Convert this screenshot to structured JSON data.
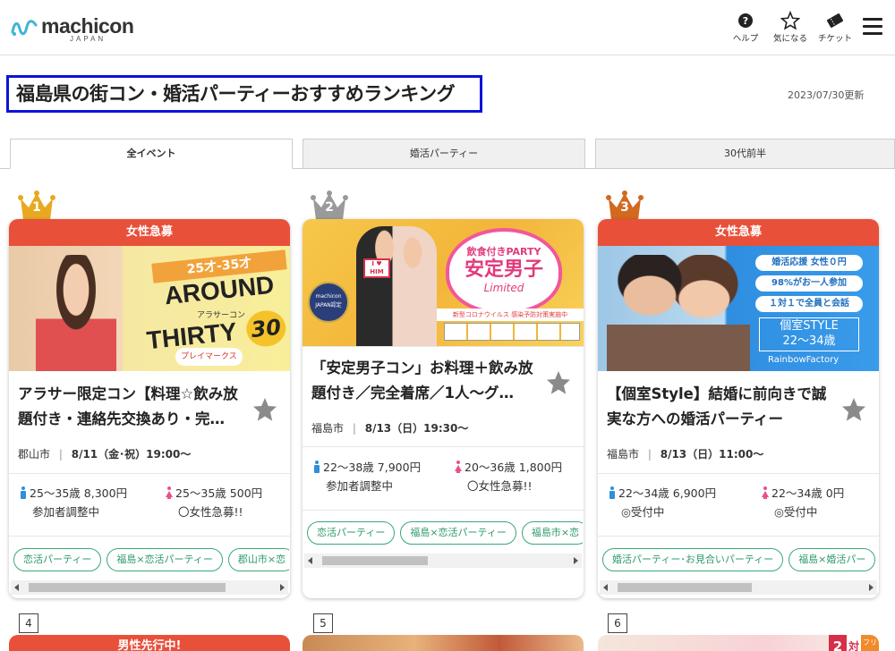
{
  "header": {
    "logo_text": "machicon",
    "logo_sub": "JAPAN",
    "nav": [
      {
        "label": "ヘルプ",
        "icon": "help-icon"
      },
      {
        "label": "気になる",
        "icon": "star-icon"
      },
      {
        "label": "チケット",
        "icon": "ticket-icon"
      }
    ],
    "menu_icon": "hamburger-menu-icon"
  },
  "page": {
    "title": "福島県の街コン・婚活パーティーおすすめランキング",
    "updated": "2023/07/30更新"
  },
  "tabs": [
    {
      "label": "全イベント",
      "active": true
    },
    {
      "label": "婚活パーティー",
      "active": false
    },
    {
      "label": "30代前半",
      "active": false
    }
  ],
  "colors": {
    "accent_badge": "#e8503a",
    "tag_green": "#2d9a6a",
    "title_border": "#0a14d6",
    "gold": "#e8a820",
    "silver": "#9a9a9a",
    "bronze": "#d2691e",
    "male_blue": "#2f8fd8",
    "female_pink": "#e8508f"
  },
  "cards": [
    {
      "rank": "1",
      "badge": "女性急募",
      "image_text": {
        "line1": "25才-35才",
        "line2": "AROUND",
        "line3": "THIRTY",
        "line4": "30",
        "sub": "アラサーコン",
        "brand": "プレイマークス"
      },
      "title": "アラサー限定コン【料理☆飲み放題付き・連絡先交換あり・完…",
      "location": "郡山市",
      "datetime": "8/11（金･祝）19:00〜",
      "male": {
        "age_price": "25〜35歳 8,300円",
        "status": "参加者調整中"
      },
      "female": {
        "age_price": "25〜35歳 500円",
        "status": "〇女性急募!!"
      },
      "tags": [
        "恋活パーティー",
        "福島×恋活パーティー",
        "郡山市×恋"
      ]
    },
    {
      "rank": "2",
      "badge": "",
      "image_text": {
        "line1": "飲食付きPARTY",
        "line2": "安定男子",
        "line3": "Limited",
        "seal": "machicon JAPAN認定",
        "banner": "新型コロナウイルス 感染予防対策実施中",
        "card": "I ♥ HIM"
      },
      "title": "「安定男子コン」お料理＋飲み放題付き／完全着席／1人〜グ…",
      "location": "福島市",
      "datetime": "8/13（日）19:30〜",
      "male": {
        "age_price": "22〜38歳 7,900円",
        "status": "参加者調整中"
      },
      "female": {
        "age_price": "20〜36歳 1,800円",
        "status": "〇女性急募!!"
      },
      "tags": [
        "恋活パーティー",
        "福島×恋活パーティー",
        "福島市×恋"
      ]
    },
    {
      "rank": "3",
      "badge": "女性急募",
      "image_text": {
        "pill1": "婚活応援 女性０円",
        "pill2": "98%がお一人参加",
        "pill3": "１対１で全員と会話",
        "box1": "個室STYLE",
        "box2": "22〜34歳",
        "brand": "RainbowFactory"
      },
      "title": "【個室Style】結婚に前向きで誠実な方への婚活パーティー",
      "location": "福島市",
      "datetime": "8/13（日）11:00〜",
      "male": {
        "age_price": "22〜34歳 6,900円",
        "status": "◎受付中"
      },
      "female": {
        "age_price": "22〜34歳 0円",
        "status": "◎受付中"
      },
      "tags": [
        "婚活パーティー･お見合いパーティー",
        "福島×婚活パー"
      ]
    }
  ],
  "next_row": [
    {
      "rank": "4",
      "badge": "男性先行中!"
    },
    {
      "rank": "5",
      "badge": ""
    },
    {
      "rank": "6",
      "badge": ""
    }
  ],
  "row6_image_text": "2",
  "row6_image_text2": "対",
  "row6_image_text3": "フリ"
}
